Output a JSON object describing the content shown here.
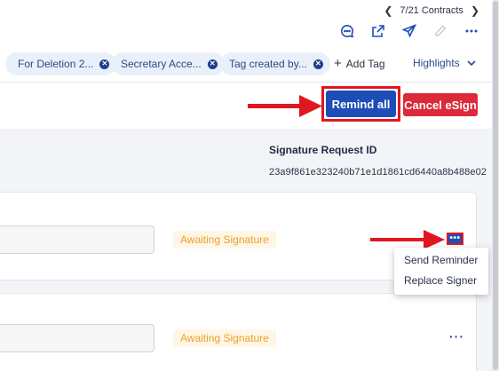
{
  "nav": {
    "counter": "7/21 Contracts",
    "prev_icon": "chevron-left-icon",
    "next_icon": "chevron-right-icon"
  },
  "toolbar_icons": [
    "comment-icon",
    "external-link-icon",
    "send-icon",
    "edit-icon",
    "more-icon"
  ],
  "tags": [
    {
      "label": "For Deletion 2..."
    },
    {
      "label": "Secretary Acce..."
    },
    {
      "label": "Tag created by..."
    }
  ],
  "add_tag": {
    "label": "Add Tag"
  },
  "highlights": {
    "label": "Highlights"
  },
  "actions": {
    "remind_all": "Remind all",
    "cancel_esign": "Cancel eSign"
  },
  "signature": {
    "label": "Signature Request ID",
    "value": "23a9f861e323240b71e1d1861cd6440a8b488e02"
  },
  "signers": [
    {
      "status": "Awaiting Signature"
    },
    {
      "status": "Awaiting Signature"
    }
  ],
  "more_menu": {
    "items": [
      "Send Reminder",
      "Replace Signer"
    ]
  },
  "colors": {
    "primary": "#1d4eb8",
    "danger": "#dc2a3b",
    "highlight_border": "#e0171f",
    "status_text": "#e8a22a",
    "status_bg": "#fff6e6",
    "tag_bg": "#eaf0f9"
  }
}
